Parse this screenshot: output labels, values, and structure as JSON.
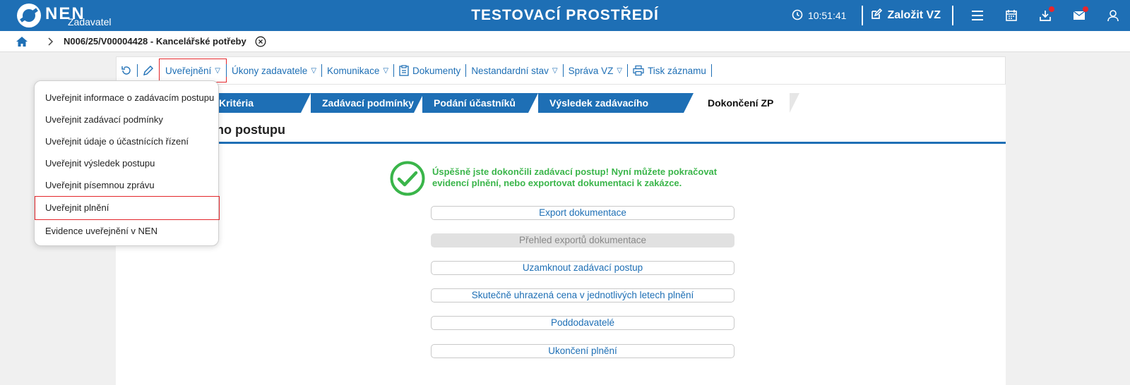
{
  "header": {
    "logo_text": "NEN",
    "logo_sub": "Zadavatel",
    "env_title": "TESTOVACÍ PROSTŘEDÍ",
    "time": "10:51:41",
    "create_label": "Založit VZ",
    "icons": [
      "clock-icon",
      "edit-icon",
      "menu-icon",
      "calendar-icon",
      "download-icon",
      "mail-icon",
      "user-icon"
    ],
    "brand_color": "#1e6fb5",
    "notification_color": "#e8262c"
  },
  "breadcrumb": {
    "title": "N006/25/V00004428 - Kancelářské potřeby"
  },
  "toolbar": {
    "items": [
      {
        "label": "Uveřejnění"
      },
      {
        "label": "Úkony zadavatele"
      },
      {
        "label": "Komunikace"
      },
      {
        "label": "Dokumenty"
      },
      {
        "label": "Nestandardní stav"
      },
      {
        "label": "Správa VZ"
      },
      {
        "label": "Tisk záznamu"
      }
    ]
  },
  "tabs": [
    {
      "label": "Kritéria hodnocení"
    },
    {
      "label": "Zadávací podmínky"
    },
    {
      "label": "Podání účastníků ZP"
    },
    {
      "label": "Výsledek zadávacího postupu"
    },
    {
      "label": "Dokončení ZP",
      "active": true
    }
  ],
  "section": {
    "title": "cího postupu"
  },
  "success": {
    "message": "Úspěšně jste dokončili zadávací postup! Nyní můžete pokračovat evidencí plnění, nebo exportovat dokumentaci k zakázce.",
    "color": "#3ab54a"
  },
  "actions": [
    {
      "label": "Export dokumentace"
    },
    {
      "label": "Přehled exportů dokumentace",
      "disabled": true
    },
    {
      "label": "Uzamknout zadávací postup"
    },
    {
      "label": "Skutečně uhrazená cena v jednotlivých letech plnění"
    },
    {
      "label": "Poddodavatelé"
    },
    {
      "label": "Ukončení plnění"
    }
  ],
  "dropdown": {
    "items": [
      {
        "label": "Uveřejnit informace o zadávacím postupu"
      },
      {
        "label": "Uveřejnit zadávací podmínky"
      },
      {
        "label": "Uveřejnit údaje o účastnících řízení"
      },
      {
        "label": "Uveřejnit výsledek postupu"
      },
      {
        "label": "Uveřejnit písemnou zprávu"
      },
      {
        "label": "Uveřejnit plnění",
        "highlighted": true
      },
      {
        "label": "Evidence uveřejnění v NEN"
      }
    ]
  }
}
